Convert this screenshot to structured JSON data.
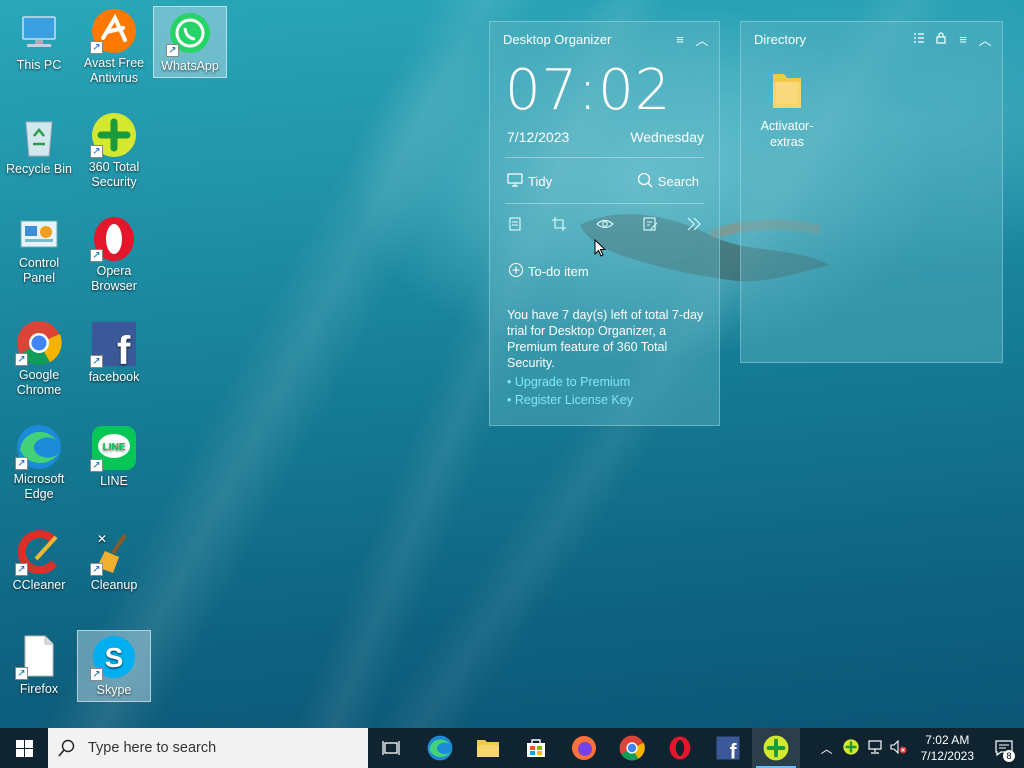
{
  "desktop_icons": [
    {
      "label": "This PC",
      "icon": "this-pc-icon"
    },
    {
      "label": "Avast Free Antivirus",
      "icon": "avast-icon"
    },
    {
      "label": "WhatsApp",
      "icon": "whatsapp-icon"
    },
    {
      "label": "Recycle Bin",
      "icon": "recycle-bin-icon"
    },
    {
      "label": "360 Total Security",
      "icon": "360-security-icon"
    },
    {
      "label": "Control Panel",
      "icon": "control-panel-icon"
    },
    {
      "label": "Opera Browser",
      "icon": "opera-icon"
    },
    {
      "label": "Google Chrome",
      "icon": "chrome-icon"
    },
    {
      "label": "facebook",
      "icon": "facebook-icon"
    },
    {
      "label": "Microsoft Edge",
      "icon": "edge-icon"
    },
    {
      "label": "LINE",
      "icon": "line-icon"
    },
    {
      "label": "CCleaner",
      "icon": "ccleaner-icon"
    },
    {
      "label": "Cleanup",
      "icon": "cleanup-icon"
    },
    {
      "label": "Firefox",
      "icon": "file-icon"
    },
    {
      "label": "Skype",
      "icon": "skype-icon"
    }
  ],
  "organizer": {
    "title": "Desktop Organizer",
    "time": "07:02",
    "date": "7/12/2023",
    "weekday": "Wednesday",
    "tidy_label": "Tidy",
    "search_label": "Search",
    "todo_label": "To-do item",
    "trial_text": "You have 7 day(s) left of total 7-day trial for Desktop Organizer, a Premium feature of 360 Total Security.",
    "upgrade_link": "• Upgrade to Premium",
    "register_link": "• Register License Key"
  },
  "directory": {
    "title": "Directory",
    "items": [
      {
        "label": "Activator-extras",
        "icon": "folder-icon"
      }
    ]
  },
  "taskbar": {
    "search_placeholder": "Type here to search",
    "apps": [
      "task-view",
      "edge",
      "file-explorer",
      "store",
      "firefox",
      "chrome",
      "opera",
      "facebook",
      "360-security"
    ],
    "time": "7:02 AM",
    "date": "7/12/2023",
    "notification_count": "8"
  },
  "colors": {
    "accent_link": "#7fe8f8",
    "taskbar": "#0f2430"
  }
}
